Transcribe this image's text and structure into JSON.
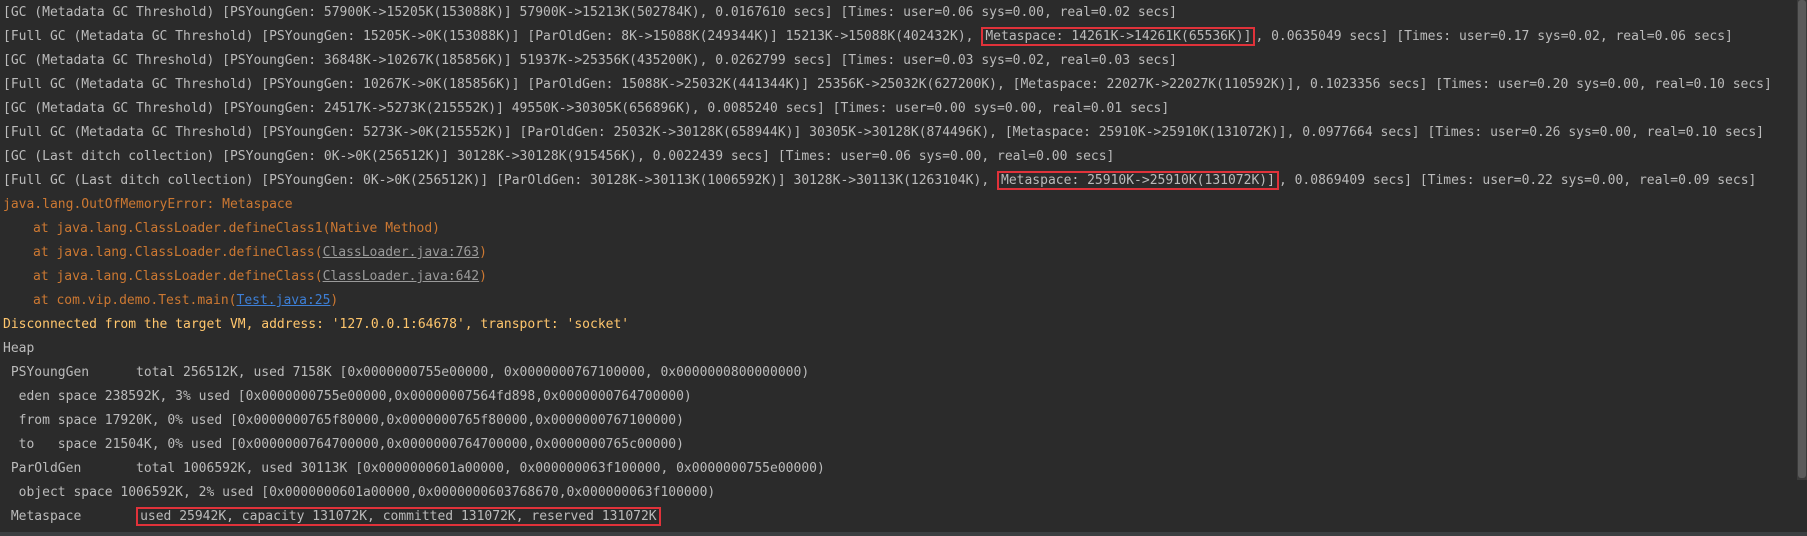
{
  "gc_log": {
    "l1": "[GC (Metadata GC Threshold) [PSYoungGen: 57900K->15205K(153088K)] 57900K->15213K(502784K), 0.0167610 secs] [Times: user=0.06 sys=0.00, real=0.02 secs]",
    "l2a": "[Full GC (Metadata GC Threshold) [PSYoungGen: 15205K->0K(153088K)] [ParOldGen: 8K->15088K(249344K)] 15213K->15088K(402432K), ",
    "l2b": "Metaspace: 14261K->14261K(65536K)]",
    "l2c": ", 0.0635049 secs] [Times: user=0.17 sys=0.02, real=0.06 secs]",
    "l3": "[GC (Metadata GC Threshold) [PSYoungGen: 36848K->10267K(185856K)] 51937K->25356K(435200K), 0.0262799 secs] [Times: user=0.03 sys=0.02, real=0.03 secs]",
    "l4": "[Full GC (Metadata GC Threshold) [PSYoungGen: 10267K->0K(185856K)] [ParOldGen: 15088K->25032K(441344K)] 25356K->25032K(627200K), [Metaspace: 22027K->22027K(110592K)], 0.1023356 secs] [Times: user=0.20 sys=0.00, real=0.10 secs]",
    "l5": "[GC (Metadata GC Threshold) [PSYoungGen: 24517K->5273K(215552K)] 49550K->30305K(656896K), 0.0085240 secs] [Times: user=0.00 sys=0.00, real=0.01 secs]",
    "l6": "[Full GC (Metadata GC Threshold) [PSYoungGen: 5273K->0K(215552K)] [ParOldGen: 25032K->30128K(658944K)] 30305K->30128K(874496K), [Metaspace: 25910K->25910K(131072K)], 0.0977664 secs] [Times: user=0.26 sys=0.00, real=0.10 secs]",
    "l7": "[GC (Last ditch collection) [PSYoungGen: 0K->0K(256512K)] 30128K->30128K(915456K), 0.0022439 secs] [Times: user=0.06 sys=0.00, real=0.00 secs]",
    "l8a": "[Full GC (Last ditch collection) [PSYoungGen: 0K->0K(256512K)] [ParOldGen: 30128K->30113K(1006592K)] 30128K->30113K(1263104K), ",
    "l8b": "Metaspace: 25910K->25910K(131072K)]",
    "l8c": ", 0.0869409 secs] [Times: user=0.22 sys=0.00, real=0.09 secs]"
  },
  "exception": {
    "title": "java.lang.OutOfMemoryError: Metaspace",
    "frames": [
      {
        "prefix": "at java.lang.ClassLoader.defineClass1(Native Method)",
        "link": "",
        "suffix": ""
      },
      {
        "prefix": "at java.lang.ClassLoader.defineClass(",
        "link": "ClassLoader.java:763",
        "suffix": ")"
      },
      {
        "prefix": "at java.lang.ClassLoader.defineClass(",
        "link": "ClassLoader.java:642",
        "suffix": ")"
      },
      {
        "prefix": "at com.vip.demo.Test.main(",
        "link": "Test.java:25",
        "suffix": ")"
      }
    ]
  },
  "disconnect": "Disconnected from the target VM, address: '127.0.0.1:64678', transport: 'socket'",
  "heap": {
    "title": "Heap",
    "young": " PSYoungGen      total 256512K, used 7158K [0x0000000755e00000, 0x0000000767100000, 0x0000000800000000)",
    "eden": "  eden space 238592K, 3% used [0x0000000755e00000,0x00000007564fd898,0x0000000764700000)",
    "from": "  from space 17920K, 0% used [0x0000000765f80000,0x0000000765f80000,0x0000000767100000)",
    "to": "  to   space 21504K, 0% used [0x0000000764700000,0x0000000764700000,0x0000000765c00000)",
    "old": " ParOldGen       total 1006592K, used 30113K [0x0000000601a00000, 0x000000063f100000, 0x0000000755e00000)",
    "object": "  object space 1006592K, 2% used [0x0000000601a00000,0x0000000603768670,0x000000063f100000)",
    "meta_label": " Metaspace       ",
    "meta_value": "used 25942K, capacity 131072K, committed 131072K, reserved 131072K"
  }
}
